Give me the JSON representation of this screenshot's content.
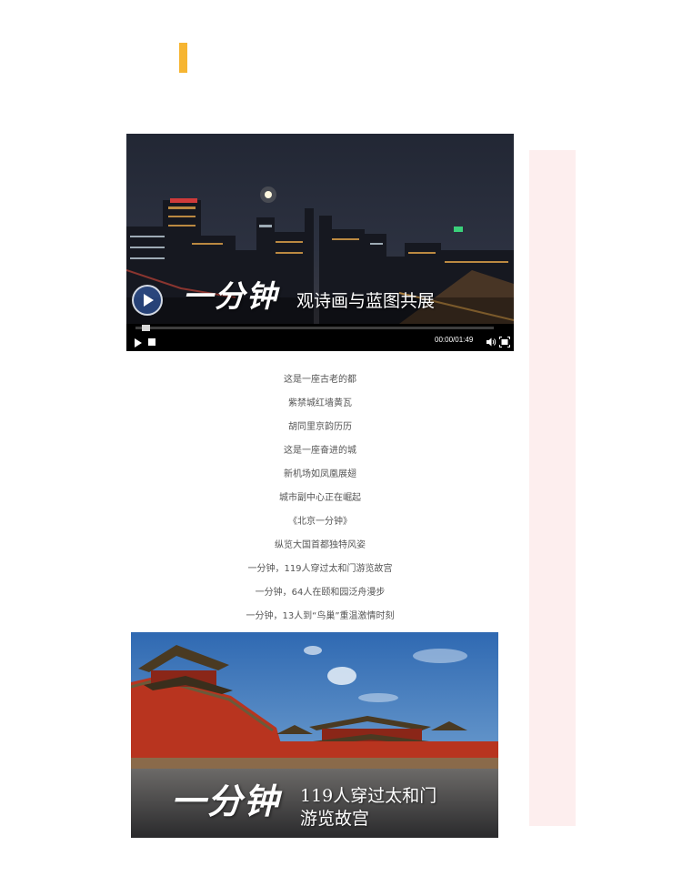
{
  "colors": {
    "accent": "#f6b532",
    "side_panel": "#fdeeee"
  },
  "video": {
    "caption_brand": "一分钟",
    "caption_subtitle": "观诗画与蓝图共展",
    "current_time": "00:00",
    "duration": "01:49",
    "progress": 0,
    "controls": {
      "play_icon": "play-icon",
      "stop_icon": "stop-icon",
      "volume_icon": "volume-icon",
      "fullscreen_icon": "fullscreen-icon"
    }
  },
  "poem": {
    "lines": [
      "这是一座古老的都",
      "紫禁城红墙黄瓦",
      "胡同里京韵历历",
      "这是一座奋进的城",
      "新机场如凤凰展翅",
      "城市副中心正在崛起",
      "《北京一分钟》",
      "纵览大国首都独特风姿",
      "一分钟，119人穿过太和门游览故宫",
      "一分钟，64人在颐和园泛舟漫步",
      "一分钟，13人到“鸟巢”重温激情时刻"
    ]
  },
  "photo": {
    "brand": "一分钟",
    "line1": "119人穿过太和门",
    "line2": "游览故宫"
  }
}
